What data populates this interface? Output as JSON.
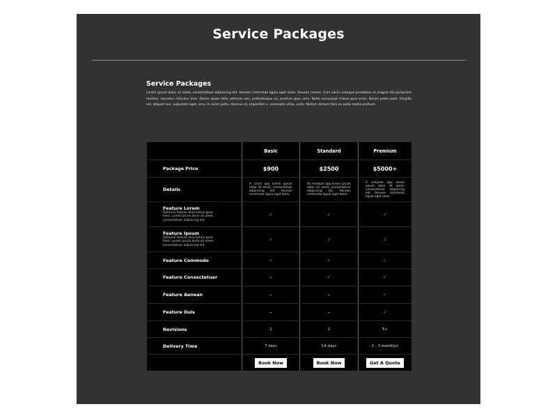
{
  "page": {
    "title": "Service Packages",
    "intro_heading": "Service Packages",
    "intro_body": "Lorem ipsum dolor sit amet, consectetuer adipiscing elit. Aenean commodo ligula eget dolor. Aenean massa. Cum sociis natoque penatibus et magnis dis parturient montes, nascetur ridiculus mus. Donec quam felis, ultricies nec, pellentesque eu, pretium quis, sem. Nulla consequat massa quis enim. Donec pede justo, fringilla vel, aliquet nec, vulputate eget, arcu. In enim justo, rhoncus ut, imperdiet a, venenatis vitae, justo. Nullam dictum felis eu pede mollis pretium."
  },
  "colors": {
    "panel_bg": "#323232",
    "table_bg": "#000000",
    "check": "#2ec84a",
    "button_bg": "#ffffff"
  },
  "pricing": {
    "plans": [
      "Basic",
      "Standard",
      "Premium"
    ],
    "rows": {
      "price": {
        "label": "Package Price",
        "values": [
          "$900",
          "$2500",
          "$5000+"
        ]
      },
      "details": {
        "label": "Details",
        "values": [
          "A small app lorem ipsum dolor sit amet, consectetuer adipiscing elit. Aenean commodo ligula eget dolor.",
          "An medium app lorem ipsum dolor sit amet, consectetuer adipiscing elit. Aenean commodo ligula eget dolor.",
          "A complex app lorem ipsum dolor sit amet, consectetuer adipiscing elit. Aenean commodo ligula eget dolor."
        ]
      },
      "features": [
        {
          "label": "Feature Lorem",
          "description": "Optional feature description goes here. Lorem ipsum dolor sit amet, consectetuer adipiscing elit.",
          "values": [
            "check",
            "check",
            "check"
          ]
        },
        {
          "label": "Feature Ipsum",
          "description": "Optional feature description goes here. Lorem ipsum dolor sit amet, consectetuer adipiscing elit.",
          "values": [
            "check",
            "check",
            "check"
          ]
        },
        {
          "label": "Feature Commodo",
          "description": "",
          "values": [
            "check",
            "check",
            "check"
          ]
        },
        {
          "label": "Feature Consectetuer",
          "description": "",
          "values": [
            "dash",
            "check",
            "check"
          ]
        },
        {
          "label": "Feature Aenean",
          "description": "",
          "values": [
            "dash",
            "dash",
            "check"
          ]
        },
        {
          "label": "Feature Duis",
          "description": "",
          "values": [
            "dash",
            "dash",
            "check"
          ]
        }
      ],
      "revisions": {
        "label": "Revisions",
        "values": [
          "1",
          "2",
          "5+"
        ]
      },
      "delivery": {
        "label": "Delivery Time",
        "values": [
          "7 days",
          "14 days",
          "2 - 3 month(s)"
        ]
      },
      "cta": {
        "values": [
          "Book Now",
          "Book Now",
          "Get A Quote"
        ]
      }
    },
    "symbols": {
      "check": "✓",
      "dash": "–"
    }
  }
}
